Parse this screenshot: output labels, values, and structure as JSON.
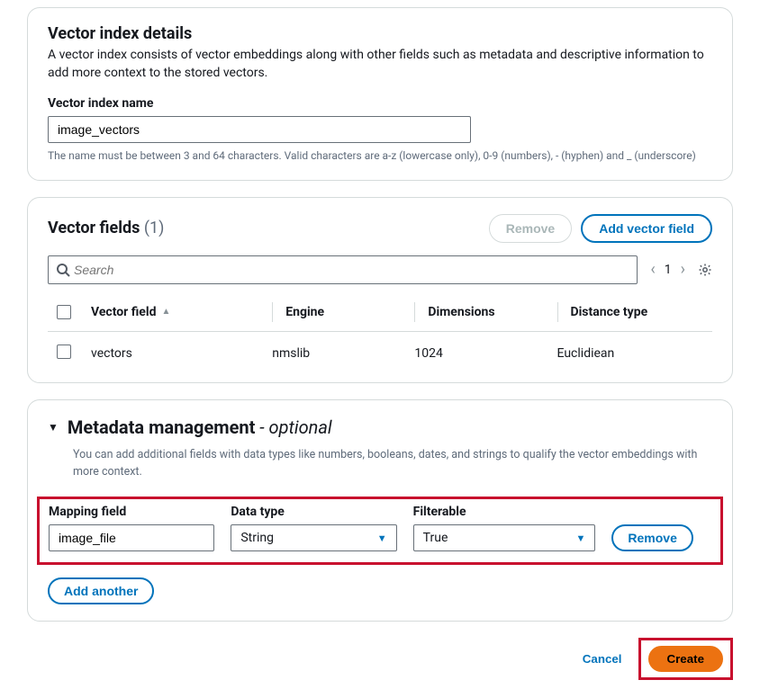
{
  "index_details": {
    "title": "Vector index details",
    "desc": "A vector index consists of vector embeddings along with other fields such as metadata and descriptive information to add more context to the stored vectors.",
    "name_label": "Vector index name",
    "name_value": "image_vectors",
    "name_helper": "The name must be between 3 and 64 characters. Valid characters are a-z (lowercase only), 0-9 (numbers), - (hyphen) and _ (underscore)"
  },
  "vector_fields": {
    "title": "Vector fields",
    "count_display": "(1)",
    "remove_label": "Remove",
    "add_label": "Add vector field",
    "search_placeholder": "Search",
    "page_num": "1",
    "columns": {
      "vector_field": "Vector field",
      "engine": "Engine",
      "dimensions": "Dimensions",
      "distance": "Distance type"
    },
    "rows": [
      {
        "field": "vectors",
        "engine": "nmslib",
        "dimensions": "1024",
        "distance": "Euclidiean"
      }
    ]
  },
  "metadata": {
    "title": "Metadata management",
    "optional_suffix": " - optional",
    "desc": "You can add additional fields with data types like numbers, booleans, dates, and strings to qualify the vector embeddings with more context.",
    "columns": {
      "mapping": "Mapping field",
      "data_type": "Data type",
      "filterable": "Filterable"
    },
    "row": {
      "mapping_value": "image_file",
      "data_type_value": "String",
      "filterable_value": "True",
      "remove_label": "Remove"
    },
    "add_another_label": "Add another"
  },
  "footer": {
    "cancel_label": "Cancel",
    "create_label": "Create"
  }
}
